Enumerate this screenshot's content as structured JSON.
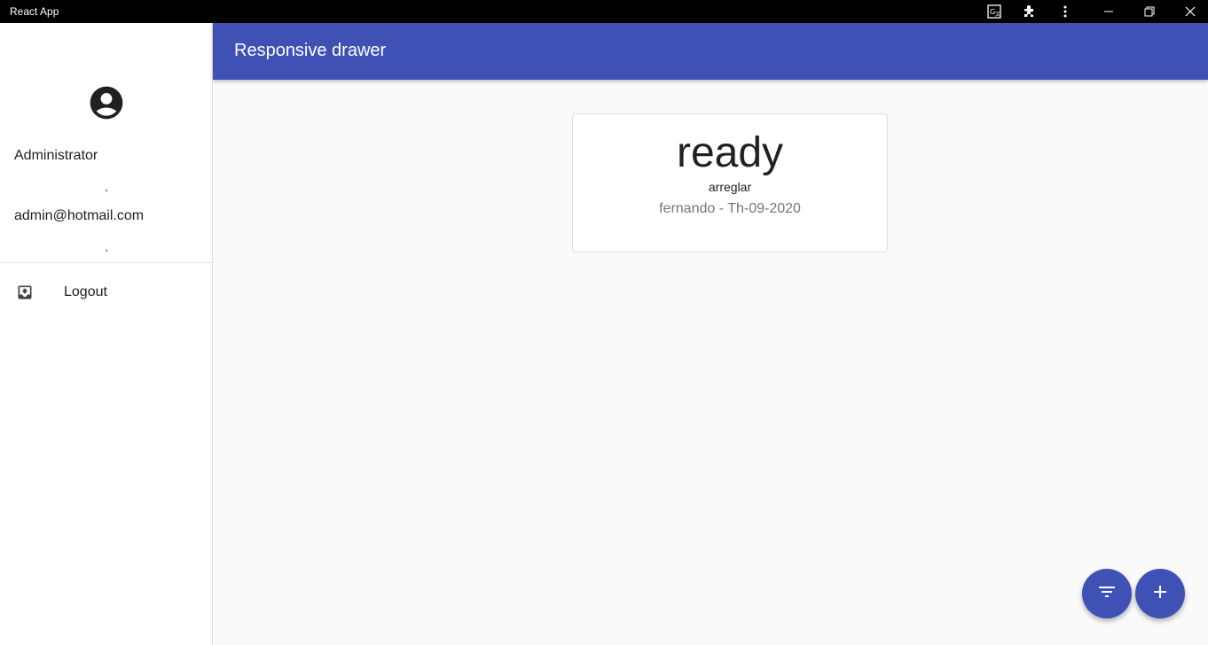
{
  "window": {
    "title": "React App",
    "icons": [
      "translate-icon",
      "extensions-icon",
      "more-vert-icon",
      "minimize-icon",
      "restore-icon",
      "close-icon"
    ]
  },
  "drawer": {
    "user_name": "Administrator",
    "separator": ",",
    "user_email": "admin@hotmail.com",
    "items": [
      {
        "label": "Logout",
        "icon": "logout-icon"
      }
    ]
  },
  "appbar": {
    "title": "Responsive drawer",
    "color": "#3f51b5"
  },
  "cards": [
    {
      "status": "ready",
      "description": "arreglar",
      "meta": "fernando - Th-09-2020"
    }
  ],
  "fabs": {
    "filter_icon": "filter-list-icon",
    "add_icon": "add-icon",
    "color": "#3f51b5"
  }
}
